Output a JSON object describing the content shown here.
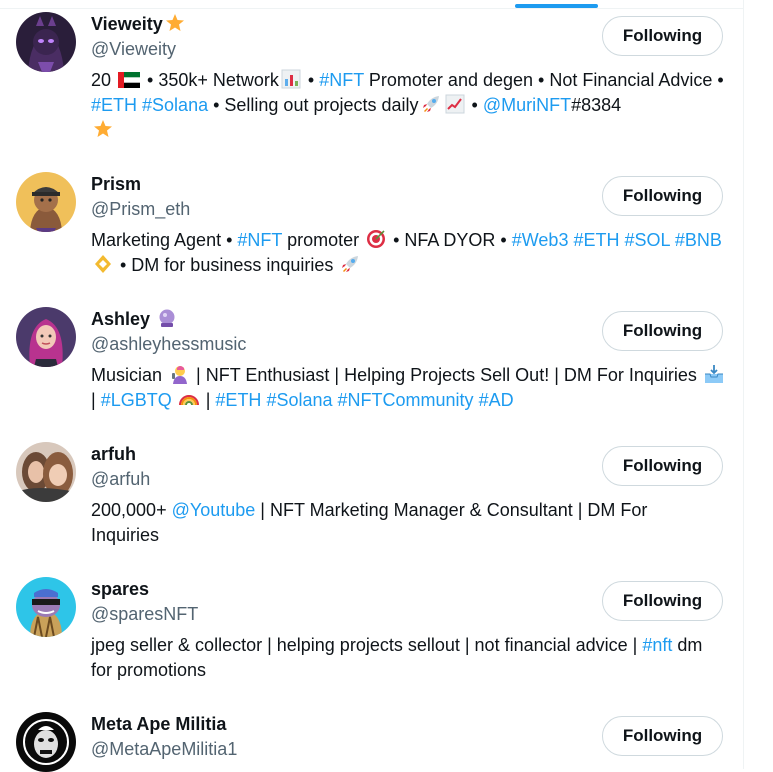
{
  "follow_button_label": "Following",
  "users": [
    {
      "name": "Vieweity",
      "handle": "@Vieweity",
      "bio": {
        "t1": "20 ",
        "t2": " • 350k+ Network",
        "t3": " • ",
        "l1": "#NFT",
        "t4": " Promoter and degen • Not Financial Advice • ",
        "l2": "#ETH",
        "t5": " ",
        "l3": "#Solana",
        "t6": " • Selling out projects daily",
        "t7": " • ",
        "l4": "@MuriNFT",
        "t8": "#8384"
      }
    },
    {
      "name": "Prism",
      "handle": "@Prism_eth",
      "bio": {
        "t1": "Marketing Agent • ",
        "l1": "#NFT",
        "t2": " promoter ",
        "t3": " • NFA DYOR • ",
        "l2": "#Web3",
        "t4": " ",
        "l3": "#ETH",
        "t5": " ",
        "l4": "#SOL",
        "t6": " ",
        "l5": "#BNB",
        "t7": " • DM for business inquiries "
      }
    },
    {
      "name": "Ashley",
      "handle": "@ashleyhessmusic",
      "bio": {
        "t1": "Musician ",
        "t2": " | NFT Enthusiast | Helping Projects Sell Out! | DM For Inquiries ",
        "t3": " | ",
        "l1": "#LGBTQ",
        "t4": " ",
        "t5": " | ",
        "l2": "#ETH",
        "t6": " ",
        "l3": "#Solana",
        "t7": " ",
        "l4": "#NFTCommunity",
        "t8": " ",
        "l5": "#AD"
      }
    },
    {
      "name": "arfuh",
      "handle": "@arfuh",
      "bio": {
        "t1": "200,000+ ",
        "l1": "@Youtube",
        "t2": " | NFT Marketing Manager & Consultant | DM For Inquiries"
      }
    },
    {
      "name": "spares",
      "handle": "@sparesNFT",
      "bio": {
        "t1": "jpeg seller & collector | helping projects sellout | not financial advice | ",
        "l1": "#nft",
        "t2": " dm for promotions"
      }
    },
    {
      "name": "Meta Ape Militia",
      "handle": "@MetaApeMilitia1"
    }
  ]
}
